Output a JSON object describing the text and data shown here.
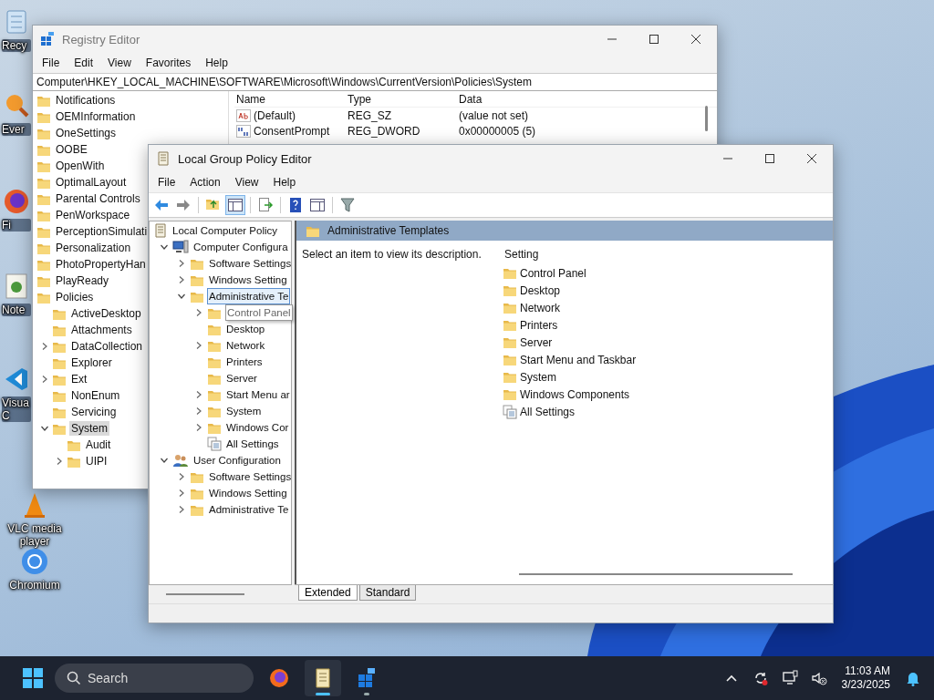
{
  "desktop_icons": [
    {
      "label": "Recy"
    },
    {
      "label": "Ever"
    },
    {
      "label": "Fi"
    },
    {
      "label": "Note"
    },
    {
      "label": "Visua C"
    },
    {
      "label": "VLC media player"
    },
    {
      "label": "Chromium"
    }
  ],
  "registry_editor": {
    "title": "Registry Editor",
    "menu": [
      "File",
      "Edit",
      "View",
      "Favorites",
      "Help"
    ],
    "address": "Computer\\HKEY_LOCAL_MACHINE\\SOFTWARE\\Microsoft\\Windows\\CurrentVersion\\Policies\\System",
    "tree": [
      {
        "label": "Notifications",
        "selected": false
      },
      {
        "label": "OEMInformation",
        "selected": false
      },
      {
        "label": "OneSettings",
        "selected": false
      },
      {
        "label": "OOBE",
        "selected": false
      },
      {
        "label": "OpenWith",
        "selected": false
      },
      {
        "label": "OptimalLayout",
        "selected": false
      },
      {
        "label": "Parental Controls",
        "selected": false
      },
      {
        "label": "PenWorkspace",
        "selected": false
      },
      {
        "label": "PerceptionSimulati",
        "selected": false
      },
      {
        "label": "Personalization",
        "selected": false
      },
      {
        "label": "PhotoPropertyHan",
        "selected": false
      },
      {
        "label": "PlayReady",
        "selected": false
      },
      {
        "label": "Policies",
        "selected": false,
        "children": [
          {
            "label": "ActiveDesktop",
            "expandable": false,
            "expanded": false,
            "selected": false
          },
          {
            "label": "Attachments",
            "expandable": false,
            "expanded": false,
            "selected": false
          },
          {
            "label": "DataCollection",
            "expandable": true,
            "expanded": false,
            "selected": false
          },
          {
            "label": "Explorer",
            "expandable": false,
            "expanded": false,
            "selected": false
          },
          {
            "label": "Ext",
            "expandable": true,
            "expanded": false,
            "selected": false
          },
          {
            "label": "NonEnum",
            "expandable": false,
            "expanded": false,
            "selected": false
          },
          {
            "label": "Servicing",
            "expandable": false,
            "expanded": false,
            "selected": false
          },
          {
            "label": "System",
            "expandable": true,
            "expanded": true,
            "selected": true,
            "children": [
              {
                "label": "Audit",
                "expandable": false,
                "expanded": false,
                "selected": false
              },
              {
                "label": "UIPI",
                "expandable": true,
                "expanded": false,
                "selected": false
              }
            ]
          }
        ]
      }
    ],
    "columns": [
      "Name",
      "Type",
      "Data"
    ],
    "rows": [
      {
        "name": "(Default)",
        "type": "REG_SZ",
        "data": "(value not set)"
      },
      {
        "name": "ConsentPrompt",
        "type": "REG_DWORD",
        "data": "0x00000005 (5)"
      }
    ]
  },
  "group_policy_editor": {
    "title": "Local Group Policy Editor",
    "menu": [
      "File",
      "Action",
      "View",
      "Help"
    ],
    "toolbar": [
      {
        "pressed": false
      },
      {
        "pressed": false
      },
      {
        "pressed": false
      },
      {
        "pressed": true
      },
      {
        "pressed": false
      },
      {
        "pressed": false
      },
      {
        "pressed": false
      },
      {
        "pressed": false
      }
    ],
    "tree": [
      {
        "label": "Local Computer Policy",
        "kind": "policy",
        "selected": false,
        "hovered": false,
        "children": [
          {
            "label": "Computer Configura",
            "kind": "computer",
            "expandable": true,
            "expanded": true,
            "selected": false,
            "hovered": false,
            "children": [
              {
                "label": "Software Settings",
                "kind": "folder",
                "expandable": true,
                "expanded": false,
                "selected": false,
                "hovered": false
              },
              {
                "label": "Windows Setting",
                "kind": "folder",
                "expandable": true,
                "expanded": false,
                "selected": false,
                "hovered": false
              },
              {
                "label": "Administrative Te",
                "kind": "folder",
                "expandable": true,
                "expanded": true,
                "selected": true,
                "hovered": false,
                "children": [
                  {
                    "label": "Control Panel",
                    "kind": "folder",
                    "expandable": true,
                    "expanded": false,
                    "selected": false,
                    "hovered": true
                  },
                  {
                    "label": "Desktop",
                    "kind": "folder",
                    "expandable": false,
                    "expanded": false,
                    "selected": false,
                    "hovered": false
                  },
                  {
                    "label": "Network",
                    "kind": "folder",
                    "expandable": true,
                    "expanded": false,
                    "selected": false,
                    "hovered": false
                  },
                  {
                    "label": "Printers",
                    "kind": "folder",
                    "expandable": false,
                    "expanded": false,
                    "selected": false,
                    "hovered": false
                  },
                  {
                    "label": "Server",
                    "kind": "folder",
                    "expandable": false,
                    "expanded": false,
                    "selected": false,
                    "hovered": false
                  },
                  {
                    "label": "Start Menu ar",
                    "kind": "folder",
                    "expandable": true,
                    "expanded": false,
                    "selected": false,
                    "hovered": false
                  },
                  {
                    "label": "System",
                    "kind": "folder",
                    "expandable": true,
                    "expanded": false,
                    "selected": false,
                    "hovered": false
                  },
                  {
                    "label": "Windows Cor",
                    "kind": "folder",
                    "expandable": true,
                    "expanded": false,
                    "selected": false,
                    "hovered": false
                  },
                  {
                    "label": "All Settings",
                    "kind": "settings",
                    "expandable": false,
                    "expanded": false,
                    "selected": false,
                    "hovered": false
                  }
                ]
              }
            ]
          },
          {
            "label": "User Configuration",
            "kind": "user",
            "expandable": true,
            "expanded": true,
            "selected": false,
            "hovered": false,
            "children": [
              {
                "label": "Software Settings",
                "kind": "folder",
                "expandable": true,
                "expanded": false,
                "selected": false,
                "hovered": false
              },
              {
                "label": "Windows Setting",
                "kind": "folder",
                "expandable": true,
                "expanded": false,
                "selected": false,
                "hovered": false
              },
              {
                "label": "Administrative Te",
                "kind": "folder",
                "expandable": true,
                "expanded": false,
                "selected": false,
                "hovered": false
              }
            ]
          }
        ]
      }
    ],
    "header": "Administrative Templates",
    "description": "Select an item to view its description.",
    "list_column": "Setting",
    "list_items": [
      {
        "label": "Control Panel",
        "kind": "folder"
      },
      {
        "label": "Desktop",
        "kind": "folder"
      },
      {
        "label": "Network",
        "kind": "folder"
      },
      {
        "label": "Printers",
        "kind": "folder"
      },
      {
        "label": "Server",
        "kind": "folder"
      },
      {
        "label": "Start Menu and Taskbar",
        "kind": "folder"
      },
      {
        "label": "System",
        "kind": "folder"
      },
      {
        "label": "Windows Components",
        "kind": "folder"
      },
      {
        "label": "All Settings",
        "kind": "settings"
      }
    ],
    "tabs": [
      {
        "label": "Extended",
        "selected": true
      },
      {
        "label": "Standard",
        "selected": false
      }
    ]
  },
  "taskbar": {
    "search": {
      "placeholder": "Search"
    },
    "apps": [
      {
        "open": false,
        "focused": false
      },
      {
        "open": true,
        "focused": true
      },
      {
        "open": true,
        "focused": false
      }
    ],
    "time": "11:03 AM",
    "date": "3/23/2025"
  }
}
